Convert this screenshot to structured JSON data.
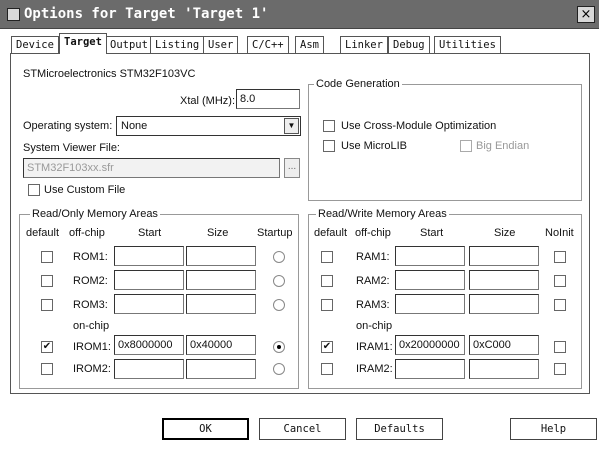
{
  "window": {
    "title": "Options for Target 'Target 1'",
    "close_glyph": "×"
  },
  "tabs": [
    "Device",
    "Target",
    "Output",
    "Listing",
    "User",
    "C/C++",
    "Asm",
    "Linker",
    "Debug",
    "Utilities"
  ],
  "device_name": "STMicroelectronics STM32F103VC",
  "xtal": {
    "label": "Xtal (MHz):",
    "value": "8.0"
  },
  "os": {
    "label": "Operating system:",
    "value": "None"
  },
  "svf": {
    "label": "System Viewer File:",
    "value": "STM32F103xx.sfr",
    "browse": "..."
  },
  "use_custom_file": {
    "label": "Use Custom File",
    "checked": false
  },
  "code_gen": {
    "title": "Code Generation",
    "cross_module": {
      "label": "Use Cross-Module Optimization",
      "checked": false
    },
    "microlib": {
      "label": "Use MicroLIB",
      "checked": false
    },
    "big_endian": {
      "label": "Big Endian",
      "checked": false,
      "enabled": false
    }
  },
  "rom": {
    "title": "Read/Only Memory Areas",
    "headers": {
      "default": "default",
      "offchip": "off-chip",
      "start": "Start",
      "size": "Size",
      "extra": "Startup"
    },
    "onchip_label": "on-chip",
    "rows": [
      {
        "name": "ROM1:",
        "default": false,
        "start": "",
        "size": "",
        "startup": false
      },
      {
        "name": "ROM2:",
        "default": false,
        "start": "",
        "size": "",
        "startup": false
      },
      {
        "name": "ROM3:",
        "default": false,
        "start": "",
        "size": "",
        "startup": false
      },
      {
        "name": "IROM1:",
        "default": true,
        "start": "0x8000000",
        "size": "0x40000",
        "startup": true
      },
      {
        "name": "IROM2:",
        "default": false,
        "start": "",
        "size": "",
        "startup": false
      }
    ]
  },
  "ram": {
    "title": "Read/Write Memory Areas",
    "headers": {
      "default": "default",
      "offchip": "off-chip",
      "start": "Start",
      "size": "Size",
      "extra": "NoInit"
    },
    "onchip_label": "on-chip",
    "rows": [
      {
        "name": "RAM1:",
        "default": false,
        "start": "",
        "size": "",
        "noinit": false
      },
      {
        "name": "RAM2:",
        "default": false,
        "start": "",
        "size": "",
        "noinit": false
      },
      {
        "name": "RAM3:",
        "default": false,
        "start": "",
        "size": "",
        "noinit": false
      },
      {
        "name": "IRAM1:",
        "default": true,
        "start": "0x20000000",
        "size": "0xC000",
        "noinit": false
      },
      {
        "name": "IRAM2:",
        "default": false,
        "start": "",
        "size": "",
        "noinit": false
      }
    ]
  },
  "buttons": {
    "ok": "OK",
    "cancel": "Cancel",
    "defaults": "Defaults",
    "help": "Help"
  }
}
